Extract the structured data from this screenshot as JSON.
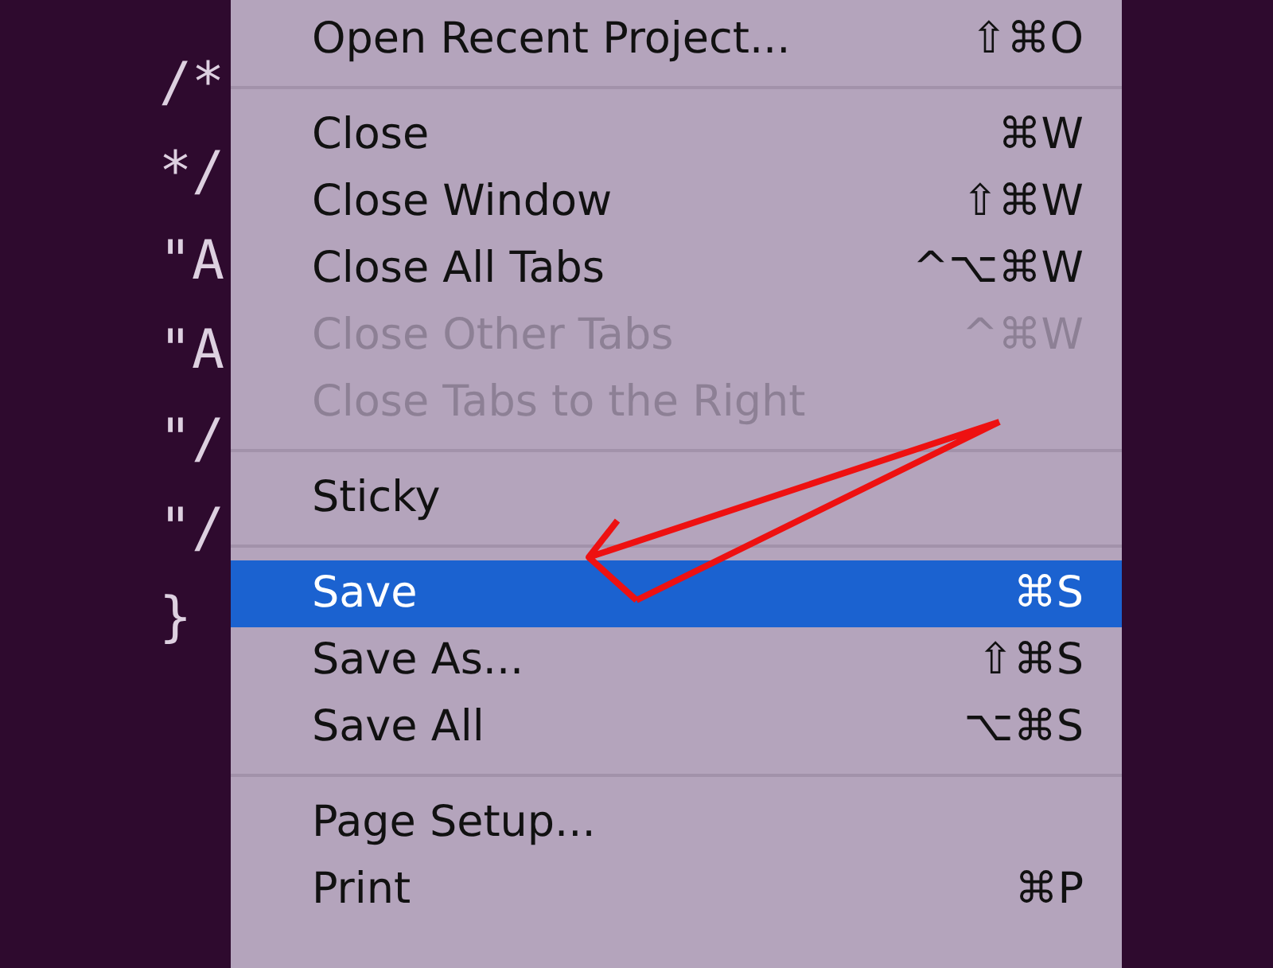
{
  "code_lines": [
    "/*",
    "*/",
    "\"A",
    "\"A",
    "\"/",
    "\"/",
    "}"
  ],
  "menu": {
    "items": [
      {
        "kind": "item",
        "label": "Open Recent Project...",
        "shortcut": "⇧⌘O",
        "disabled": false,
        "selected": false
      },
      {
        "kind": "separator"
      },
      {
        "kind": "item",
        "label": "Close",
        "shortcut": "⌘W",
        "disabled": false,
        "selected": false
      },
      {
        "kind": "item",
        "label": "Close Window",
        "shortcut": "⇧⌘W",
        "disabled": false,
        "selected": false
      },
      {
        "kind": "item",
        "label": "Close All Tabs",
        "shortcut": "^⌥⌘W",
        "disabled": false,
        "selected": false
      },
      {
        "kind": "item",
        "label": "Close Other Tabs",
        "shortcut": "^⌘W",
        "disabled": true,
        "selected": false
      },
      {
        "kind": "item",
        "label": "Close Tabs to the Right",
        "disabled": true,
        "selected": false
      },
      {
        "kind": "separator"
      },
      {
        "kind": "item",
        "label": "Sticky",
        "disabled": false,
        "selected": false
      },
      {
        "kind": "separator"
      },
      {
        "kind": "item",
        "label": "Save",
        "shortcut": "⌘S",
        "disabled": false,
        "selected": true
      },
      {
        "kind": "item",
        "label": "Save As...",
        "shortcut": "⇧⌘S",
        "disabled": false,
        "selected": false
      },
      {
        "kind": "item",
        "label": "Save All",
        "shortcut": "⌥⌘S",
        "disabled": false,
        "selected": false
      },
      {
        "kind": "separator"
      },
      {
        "kind": "item",
        "label": "Page Setup...",
        "disabled": false,
        "selected": false
      },
      {
        "kind": "item",
        "label": "Print",
        "shortcut": "⌘P",
        "disabled": false,
        "selected": false
      }
    ]
  }
}
